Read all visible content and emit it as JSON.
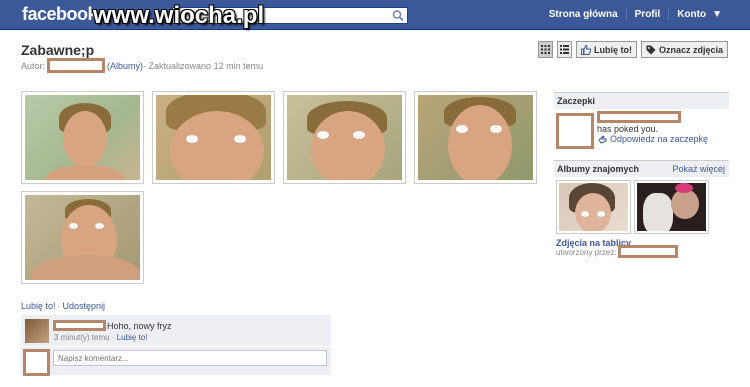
{
  "topbar": {
    "logo": "facebook",
    "watermark": "www.wiocha.pl",
    "search_placeholder": "Szuk",
    "nav": [
      "Strona główna",
      "Profil",
      "Konto"
    ]
  },
  "album": {
    "title": "Zabawne;p",
    "author_label": "Autor:",
    "albums_link": "(Albumy)",
    "updated": " · Zaktualizowano 12 min temu"
  },
  "toolbar": {
    "like_label": "Lubię to!",
    "tag_label": "Oznacz zdjęcia"
  },
  "sidebar": {
    "pokes_heading": "Zaczepki",
    "poke_text": "has poked you.",
    "poke_back": "Odpowiedz na zaczepkę",
    "friends_albums_heading": "Albumy znajomych",
    "show_more": "Pokaż więcej",
    "wall_photos": "Zdjęcia na tablicy",
    "created_by": "utworzony przez:"
  },
  "actions": {
    "like": "Lubię to!",
    "share": "Udostępnij"
  },
  "comment": {
    "text": "Hoho, nowy fryz",
    "time": "3 minut(y) temu",
    "like": "Lubię to!",
    "input_placeholder": "Napisz komentarz..."
  },
  "colors": {
    "brand": "#3b5998",
    "redaction": "#b5866a"
  }
}
